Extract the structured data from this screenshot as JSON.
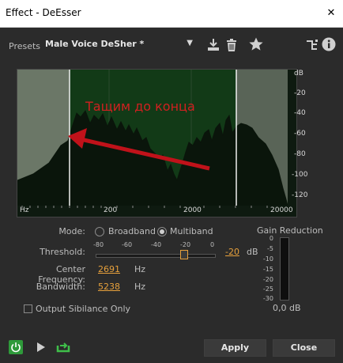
{
  "window": {
    "title": "Effect - DeEsser",
    "close_glyph": "✕"
  },
  "toolbar": {
    "presets_label": "Presets:",
    "presets_value": "Male Voice DeSher *",
    "icons": [
      "download-icon",
      "trash-icon",
      "star-icon",
      "routing-icon",
      "info-icon"
    ]
  },
  "graph": {
    "annotation": "Тащим до конца",
    "db_labels": [
      "dB",
      "-20",
      "-40",
      "-60",
      "-80",
      "-100",
      "-120"
    ],
    "freq_labels": [
      "Hz",
      "200",
      "2000",
      "20000"
    ],
    "band_color": "#123a17",
    "arrow_color": "#c0121a"
  },
  "controls": {
    "mode_label": "Mode:",
    "broadband_label": "Broadband",
    "multiband_label": "Multiband",
    "mode_selected": "Multiband",
    "threshold_label": "Threshold:",
    "threshold_ticks": [
      "-80",
      "-60",
      "-40",
      "-20",
      "0"
    ],
    "threshold_value": "-20",
    "threshold_unit": "dB",
    "center_freq_label": "Center Frequency:",
    "center_freq_value": "2691",
    "center_freq_unit": "Hz",
    "bandwidth_label": "Bandwidth:",
    "bandwidth_value": "5238",
    "bandwidth_unit": "Hz",
    "output_sibilance_label": "Output Sibilance Only"
  },
  "gain_reduction": {
    "label": "Gain Reduction",
    "ticks": [
      "0",
      "-5",
      "-10",
      "-15",
      "-20",
      "-25",
      "-30"
    ],
    "readout": "0,0 dB"
  },
  "footer": {
    "apply_label": "Apply",
    "close_label": "Close",
    "icons": [
      "power-icon",
      "play-icon",
      "loop-icon"
    ],
    "power_color": "#2e9a3a",
    "loop_color": "#3fbf4a"
  }
}
